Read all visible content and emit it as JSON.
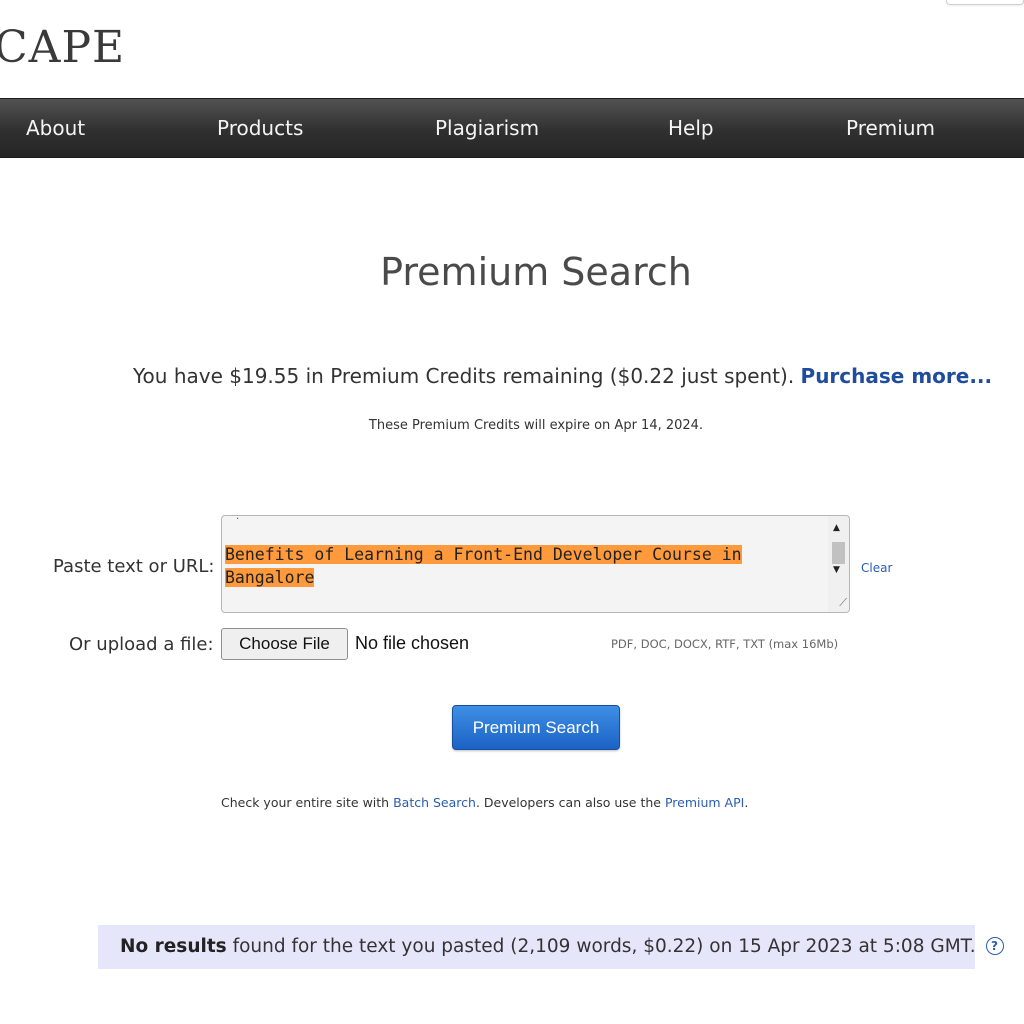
{
  "header": {
    "logo_text": "CAPE"
  },
  "nav": {
    "items": [
      {
        "label": "About"
      },
      {
        "label": "Products"
      },
      {
        "label": "Plagiarism"
      },
      {
        "label": "Help"
      },
      {
        "label": "Premium"
      }
    ]
  },
  "main": {
    "title": "Premium Search",
    "credits_text": "You have $19.55 in Premium Credits remaining ($0.22 just spent).",
    "purchase_link": "Purchase more...",
    "expiry_text": "These Premium Credits will expire on Apr 14, 2024."
  },
  "form": {
    "paste_label": "Paste text or URL:",
    "text_value": "Benefits of Learning a Front-End Developer Course in Bangalore",
    "clear_label": "Clear",
    "upload_label": "Or upload a file:",
    "choose_file_label": "Choose File",
    "file_status": "No file chosen",
    "file_types": "PDF, DOC, DOCX, RTF, TXT (max 16Mb)",
    "submit_label": "Premium Search"
  },
  "footer_note": {
    "prefix": "Check your entire site with ",
    "batch_link": "Batch Search",
    "middle": ". Developers can also use the ",
    "api_link": "Premium API",
    "suffix": "."
  },
  "result": {
    "bold": "No results",
    "text": " found for the text you pasted (2,109 words, $0.22) on 15 Apr 2023 at 5:08 GMT.",
    "help_icon": "question-circle-icon"
  }
}
